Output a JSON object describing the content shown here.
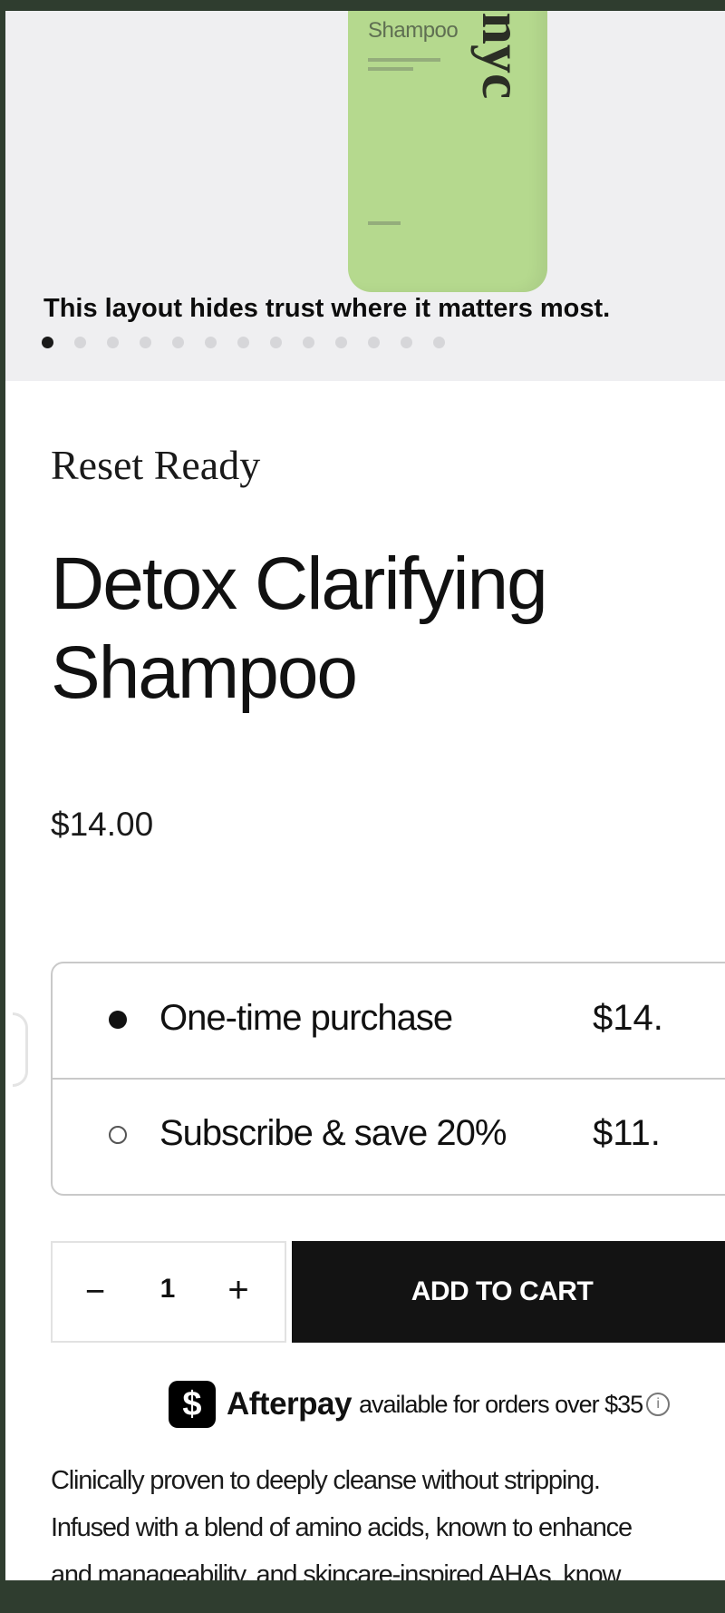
{
  "gallery": {
    "bottle_name": "Shampoo",
    "bottle_brand": "-nyc",
    "overlay_caption": "This layout hides trust where it matters most.",
    "slide_count": 13,
    "active_slide": 1
  },
  "product": {
    "collection": "Reset Ready",
    "title": "Detox Clarifying Shampoo",
    "price": "$14.00"
  },
  "purchase_options": [
    {
      "label": "One-time purchase",
      "price": "$14.",
      "selected": true
    },
    {
      "label": "Subscribe & save 20%",
      "price": "$11.",
      "selected": false
    }
  ],
  "quantity": {
    "minus": "−",
    "value": "1",
    "plus": "+"
  },
  "cart": {
    "label": "ADD TO CART"
  },
  "afterpay": {
    "icon": "$",
    "brand": "Afterpay",
    "text": "available for orders over $35",
    "info_icon": "i"
  },
  "description": {
    "lines": [
      "Clinically proven to deeply cleanse without stripping.",
      "Infused with a blend of amino acids, known to enhance",
      "and manageability, and skincare-inspired AHAs, know"
    ]
  },
  "colors": {
    "background_frame": "#2f3d2f",
    "bottle": "#b5d98e",
    "button": "#131313"
  }
}
